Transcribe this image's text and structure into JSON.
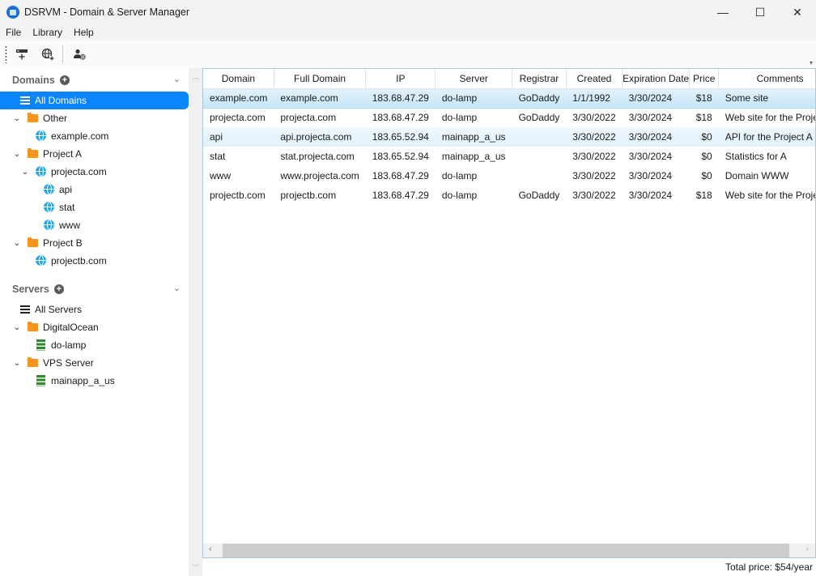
{
  "window": {
    "title": "DSRVM - Domain & Server Manager",
    "controls": {
      "minimize": "—",
      "maximize": "☐",
      "close": "✕"
    }
  },
  "menu": [
    "File",
    "Library",
    "Help"
  ],
  "toolbar": {
    "buttons": [
      {
        "name": "add-server",
        "icon": "server-plus-icon"
      },
      {
        "name": "add-domain",
        "icon": "globe-plus-icon"
      },
      {
        "name": "user-settings",
        "icon": "user-gear-icon"
      }
    ],
    "overflow": "▾"
  },
  "sidebar": {
    "domains": {
      "title": "Domains",
      "add": "+",
      "chevron": "⌄",
      "all_label": "All Domains",
      "groups": [
        {
          "label": "Other",
          "items": [
            {
              "label": "example.com",
              "children": []
            }
          ]
        },
        {
          "label": "Project A",
          "items": [
            {
              "label": "projecta.com",
              "children": [
                "api",
                "stat",
                "www"
              ]
            }
          ]
        },
        {
          "label": "Project B",
          "items": [
            {
              "label": "projectb.com",
              "children": []
            }
          ]
        }
      ]
    },
    "servers": {
      "title": "Servers",
      "add": "+",
      "chevron": "⌄",
      "all_label": "All Servers",
      "groups": [
        {
          "label": "DigitalOcean",
          "items": [
            "do-lamp"
          ]
        },
        {
          "label": "VPS Server",
          "items": [
            "mainapp_a_us"
          ]
        }
      ]
    }
  },
  "table": {
    "columns": [
      "Domain",
      "Full Domain",
      "IP",
      "Server",
      "Registrar",
      "Created",
      "Expiration Date",
      "Price",
      "Comments"
    ],
    "rows": [
      [
        "example.com",
        "example.com",
        "183.68.47.29",
        "do-lamp",
        "GoDaddy",
        "1/1/1992",
        "3/30/2024",
        "$18",
        "Some site"
      ],
      [
        "projecta.com",
        "projecta.com",
        "183.68.47.29",
        "do-lamp",
        "GoDaddy",
        "3/30/2022",
        "3/30/2024",
        "$18",
        "Web site for the Project A"
      ],
      [
        "api",
        "api.projecta.com",
        "183.65.52.94",
        "mainapp_a_us",
        "",
        "3/30/2022",
        "3/30/2024",
        "$0",
        "API for the Project A"
      ],
      [
        "stat",
        "stat.projecta.com",
        "183.65.52.94",
        "mainapp_a_us",
        "",
        "3/30/2022",
        "3/30/2024",
        "$0",
        "Statistics for A"
      ],
      [
        "www",
        "www.projecta.com",
        "183.68.47.29",
        "do-lamp",
        "",
        "3/30/2022",
        "3/30/2024",
        "$0",
        "Domain WWW"
      ],
      [
        "projectb.com",
        "projectb.com",
        "183.68.47.29",
        "do-lamp",
        "GoDaddy",
        "3/30/2022",
        "3/30/2024",
        "$18",
        "Web site for the Project B"
      ]
    ],
    "selected_row": 0,
    "hover_row": 2
  },
  "status": {
    "total": "Total price: $54/year"
  },
  "colors": {
    "accent": "#0a84ff",
    "folder": "#f7941d",
    "globe": "#24a8e3",
    "server": "#2e8b2e",
    "selection": "#c5e6fa"
  }
}
